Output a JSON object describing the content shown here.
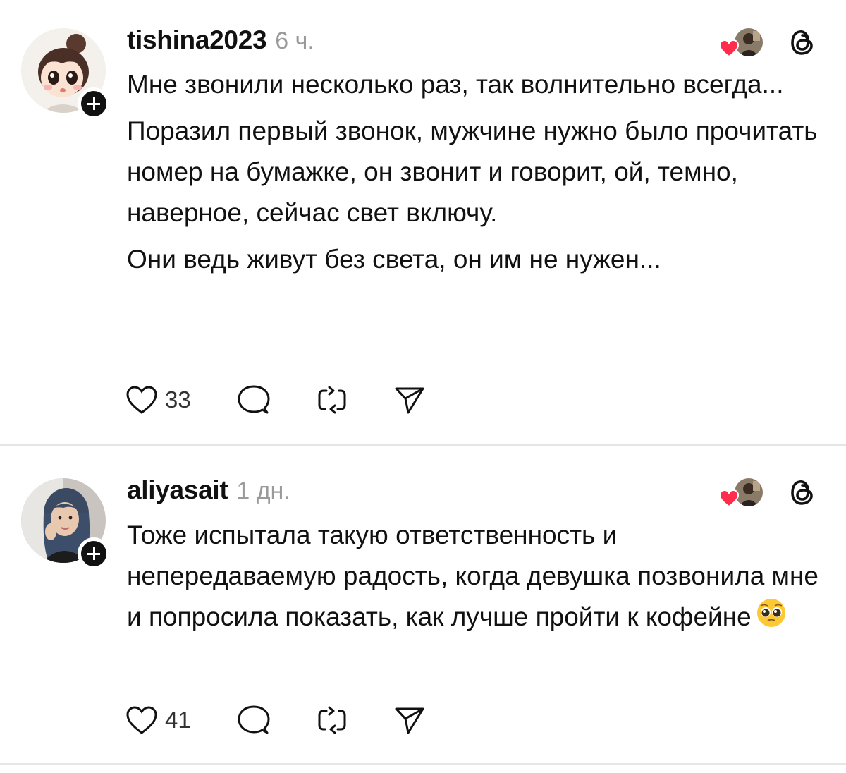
{
  "posts": [
    {
      "username": "tishina2023",
      "time": "6 ч.",
      "paragraphs": [
        "Мне звонили несколько раз, так волнительно всегда...",
        "Поразил первый звонок, мужчине нужно было прочитать номер на бумажке,  он звонит и говорит, ой, темно, наверное, сейчас свет включу.",
        "Они ведь живут без света, он им не нужен..."
      ],
      "likes": "33",
      "icons": [
        "heart-icon",
        "comment-icon",
        "repost-icon",
        "share-icon",
        "threads-logo-icon",
        "follow-plus-icon"
      ]
    },
    {
      "username": "aliyasait",
      "time": "1 дн.",
      "paragraphs": [
        "Тоже испытала такую ответственность и непередаваемую радость, когда девушка позвонила мне и попросила показать, как лучше пройти к кофейне"
      ],
      "emoji": "pleading-face-emoji",
      "likes": "41",
      "icons": [
        "heart-icon",
        "comment-icon",
        "repost-icon",
        "share-icon",
        "threads-logo-icon",
        "follow-plus-icon"
      ]
    }
  ],
  "colors": {
    "text": "#111111",
    "muted": "#9a9a9a",
    "like_red": "#ff2d4b",
    "divider": "#e6e6e6"
  }
}
